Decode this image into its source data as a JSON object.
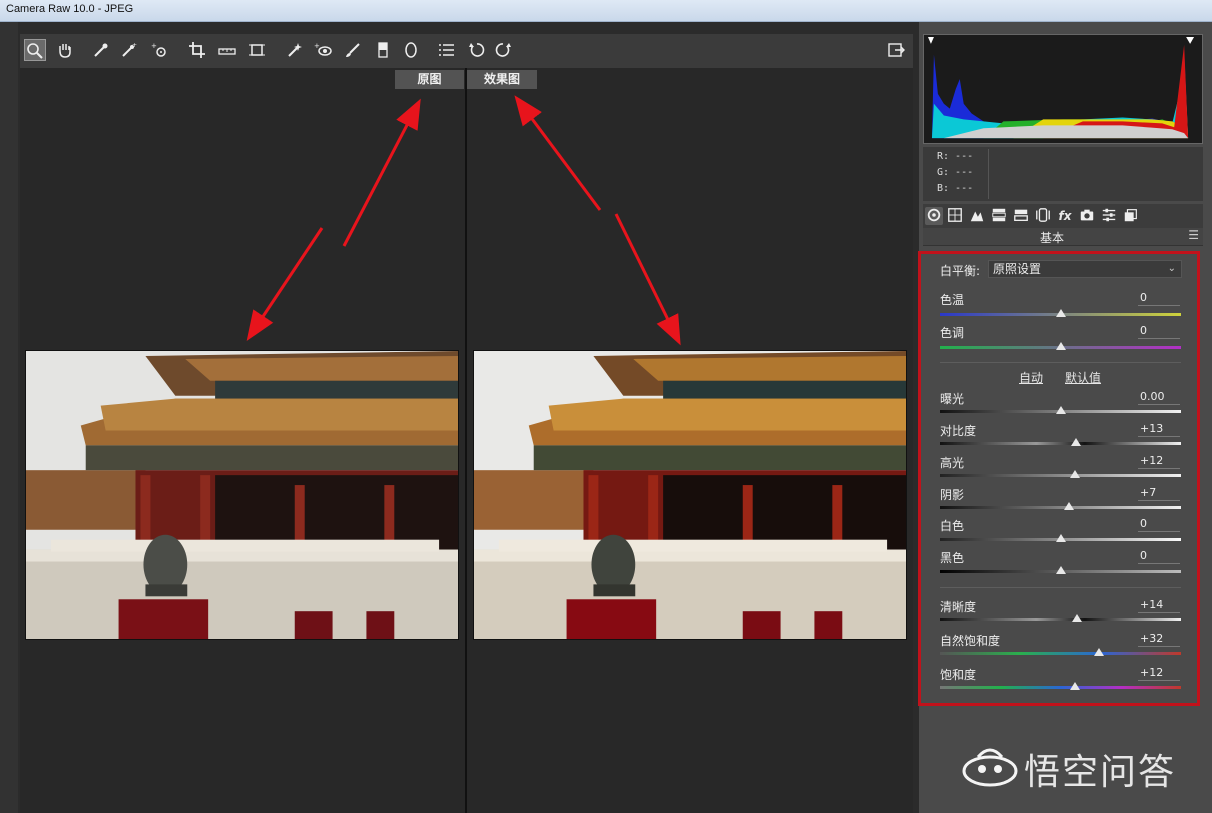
{
  "window": {
    "title": "Camera Raw 10.0 -  JPEG"
  },
  "toolbar": {
    "tools": [
      "zoom-tool",
      "hand-tool",
      "white-balance-tool",
      "color-sampler-tool",
      "targeted-adjustment-tool",
      "crop-tool",
      "straighten-tool",
      "transform-tool",
      "spot-removal-tool",
      "red-eye-tool",
      "adjustment-brush-tool",
      "graduated-filter-tool",
      "radial-filter-tool",
      "preferences-tool",
      "rotate-left-tool",
      "rotate-right-tool"
    ],
    "active_tool": "zoom-tool"
  },
  "preview": {
    "before_label": "原图",
    "after_label": "效果图"
  },
  "readout": {
    "r": "R:  ---",
    "g": "G:  ---",
    "b": "B:  ---"
  },
  "panel": {
    "title": "基本",
    "white_balance_label": "白平衡:",
    "white_balance_value": "原照设置",
    "auto_link": "自动",
    "default_link": "默认值",
    "sliders": [
      {
        "id": "temp",
        "label": "色温",
        "value": "0",
        "level": 0.5
      },
      {
        "id": "tint",
        "label": "色调",
        "value": "0",
        "level": 0.5
      },
      {
        "id": "exposure",
        "label": "曝光",
        "value": "0.00",
        "level": 0.5
      },
      {
        "id": "contrast",
        "label": "对比度",
        "value": "+13",
        "level": 0.565
      },
      {
        "id": "highlights",
        "label": "高光",
        "value": "+12",
        "level": 0.56
      },
      {
        "id": "shadows",
        "label": "阴影",
        "value": "+7",
        "level": 0.535
      },
      {
        "id": "whites",
        "label": "白色",
        "value": "0",
        "level": 0.5
      },
      {
        "id": "blacks",
        "label": "黑色",
        "value": "0",
        "level": 0.5
      },
      {
        "id": "clarity",
        "label": "清晰度",
        "value": "+14",
        "level": 0.57
      },
      {
        "id": "vibrance",
        "label": "自然饱和度",
        "value": "+32",
        "level": 0.66
      },
      {
        "id": "saturation",
        "label": "饱和度",
        "value": "+12",
        "level": 0.56
      }
    ]
  },
  "watermark": {
    "text": "悟空问答"
  },
  "colors": {
    "annotation_red": "#e8141c",
    "highlight_box": "#c1121b"
  }
}
